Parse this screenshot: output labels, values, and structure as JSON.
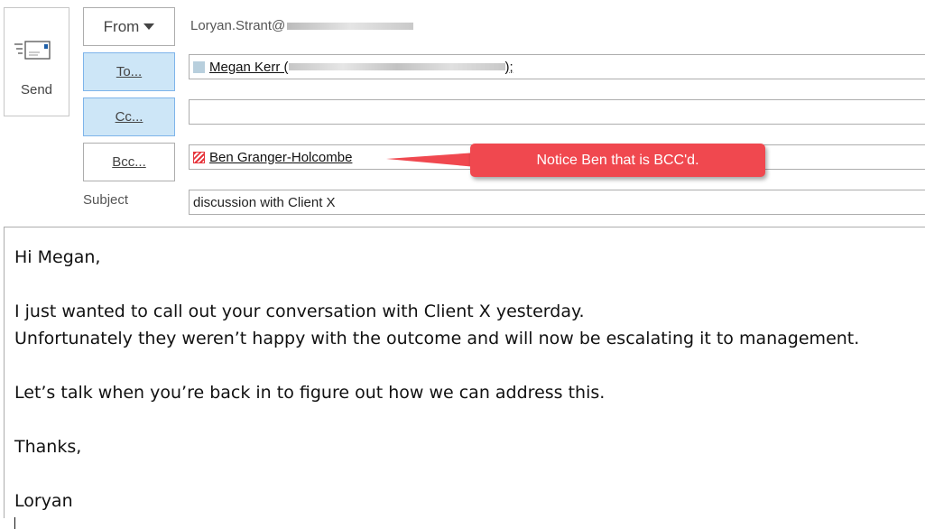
{
  "toolbar": {
    "send_label": "Send"
  },
  "header": {
    "from_button": "From",
    "from_address": "Loryan.Strant@",
    "to_button": "To...",
    "cc_button": "Cc...",
    "bcc_button": "Bcc...",
    "subject_label": "Subject"
  },
  "fields": {
    "to": {
      "name": "Megan Kerr (",
      "suffix": ");",
      "color": "#b8cfdd"
    },
    "cc": "",
    "bcc": {
      "name": "Ben Granger-Holcombe",
      "color": "#e6363d"
    },
    "subject": "discussion with Client X"
  },
  "annotation": {
    "text": "Notice Ben that is BCC'd.",
    "color": "#f0484f"
  },
  "body": {
    "greeting": "Hi Megan,",
    "line1": "I just wanted to call out your conversation with Client X yesterday.",
    "line2": "Unfortunately they weren’t happy with the outcome and will now be escalating it to management.",
    "line3": "Let’s talk when you’re back in to figure out how we can address this.",
    "closing": "Thanks,",
    "signature": "Loryan"
  }
}
